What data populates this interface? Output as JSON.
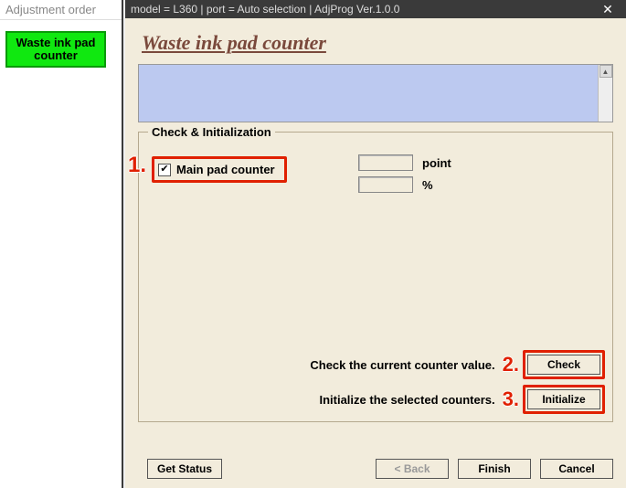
{
  "left": {
    "title": "Adjustment order",
    "nav_item": "Waste ink pad counter"
  },
  "titlebar": "model = L360 | port = Auto selection | AdjProg Ver.1.0.0",
  "heading": "Waste ink pad counter",
  "fieldset_legend": "Check & Initialization",
  "checkbox": {
    "label": "Main pad counter",
    "checked_glyph": "✔"
  },
  "values": {
    "point_unit": "point",
    "percent_unit": "%"
  },
  "actions": {
    "check_text": "Check the current counter value.",
    "init_text": "Initialize the selected counters.",
    "check_btn": "Check",
    "init_btn": "Initialize"
  },
  "bottom": {
    "get_status": "Get Status",
    "back": "< Back",
    "finish": "Finish",
    "cancel": "Cancel"
  },
  "annot": {
    "one": "1.",
    "two": "2.",
    "three": "3."
  }
}
